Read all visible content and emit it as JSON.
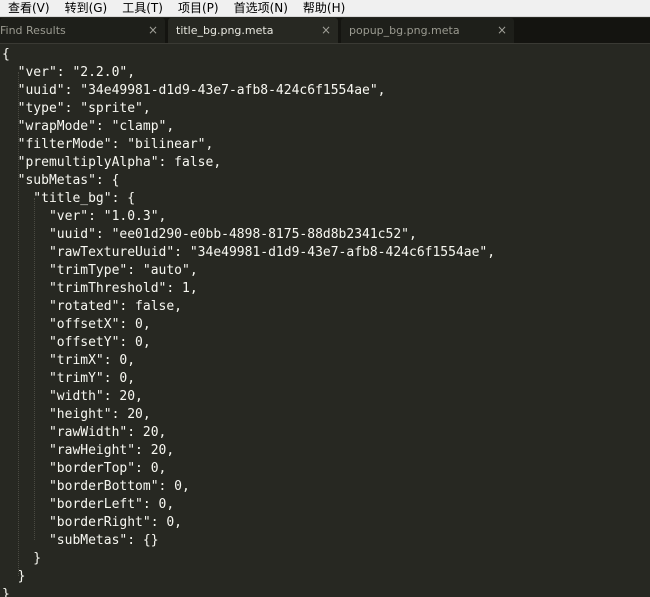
{
  "menubar": {
    "items": [
      {
        "label": "查看(V)"
      },
      {
        "label": "转到(G)"
      },
      {
        "label": "工具(T)"
      },
      {
        "label": "项目(P)"
      },
      {
        "label": "首选项(N)"
      },
      {
        "label": "帮助(H)"
      }
    ]
  },
  "tabs": [
    {
      "label": "Find Results",
      "close": "×",
      "active": false
    },
    {
      "label": "title_bg.png.meta",
      "close": "×",
      "active": true
    },
    {
      "label": "popup_bg.png.meta",
      "close": "×",
      "active": false
    }
  ],
  "editor": {
    "lines": [
      "{",
      "  \"ver\": \"2.2.0\",",
      "  \"uuid\": \"34e49981-d1d9-43e7-afb8-424c6f1554ae\",",
      "  \"type\": \"sprite\",",
      "  \"wrapMode\": \"clamp\",",
      "  \"filterMode\": \"bilinear\",",
      "  \"premultiplyAlpha\": false,",
      "  \"subMetas\": {",
      "    \"title_bg\": {",
      "      \"ver\": \"1.0.3\",",
      "      \"uuid\": \"ee01d290-e0bb-4898-8175-88d8b2341c52\",",
      "      \"rawTextureUuid\": \"34e49981-d1d9-43e7-afb8-424c6f1554ae\",",
      "      \"trimType\": \"auto\",",
      "      \"trimThreshold\": 1,",
      "      \"rotated\": false,",
      "      \"offsetX\": 0,",
      "      \"offsetY\": 0,",
      "      \"trimX\": 0,",
      "      \"trimY\": 0,",
      "      \"width\": 20,",
      "      \"height\": 20,",
      "      \"rawWidth\": 20,",
      "      \"rawHeight\": 20,",
      "      \"borderTop\": 0,",
      "      \"borderBottom\": 0,",
      "      \"borderLeft\": 0,",
      "      \"borderRight\": 0,",
      "      \"subMetas\": {}",
      "    }",
      "  }",
      "}"
    ]
  }
}
